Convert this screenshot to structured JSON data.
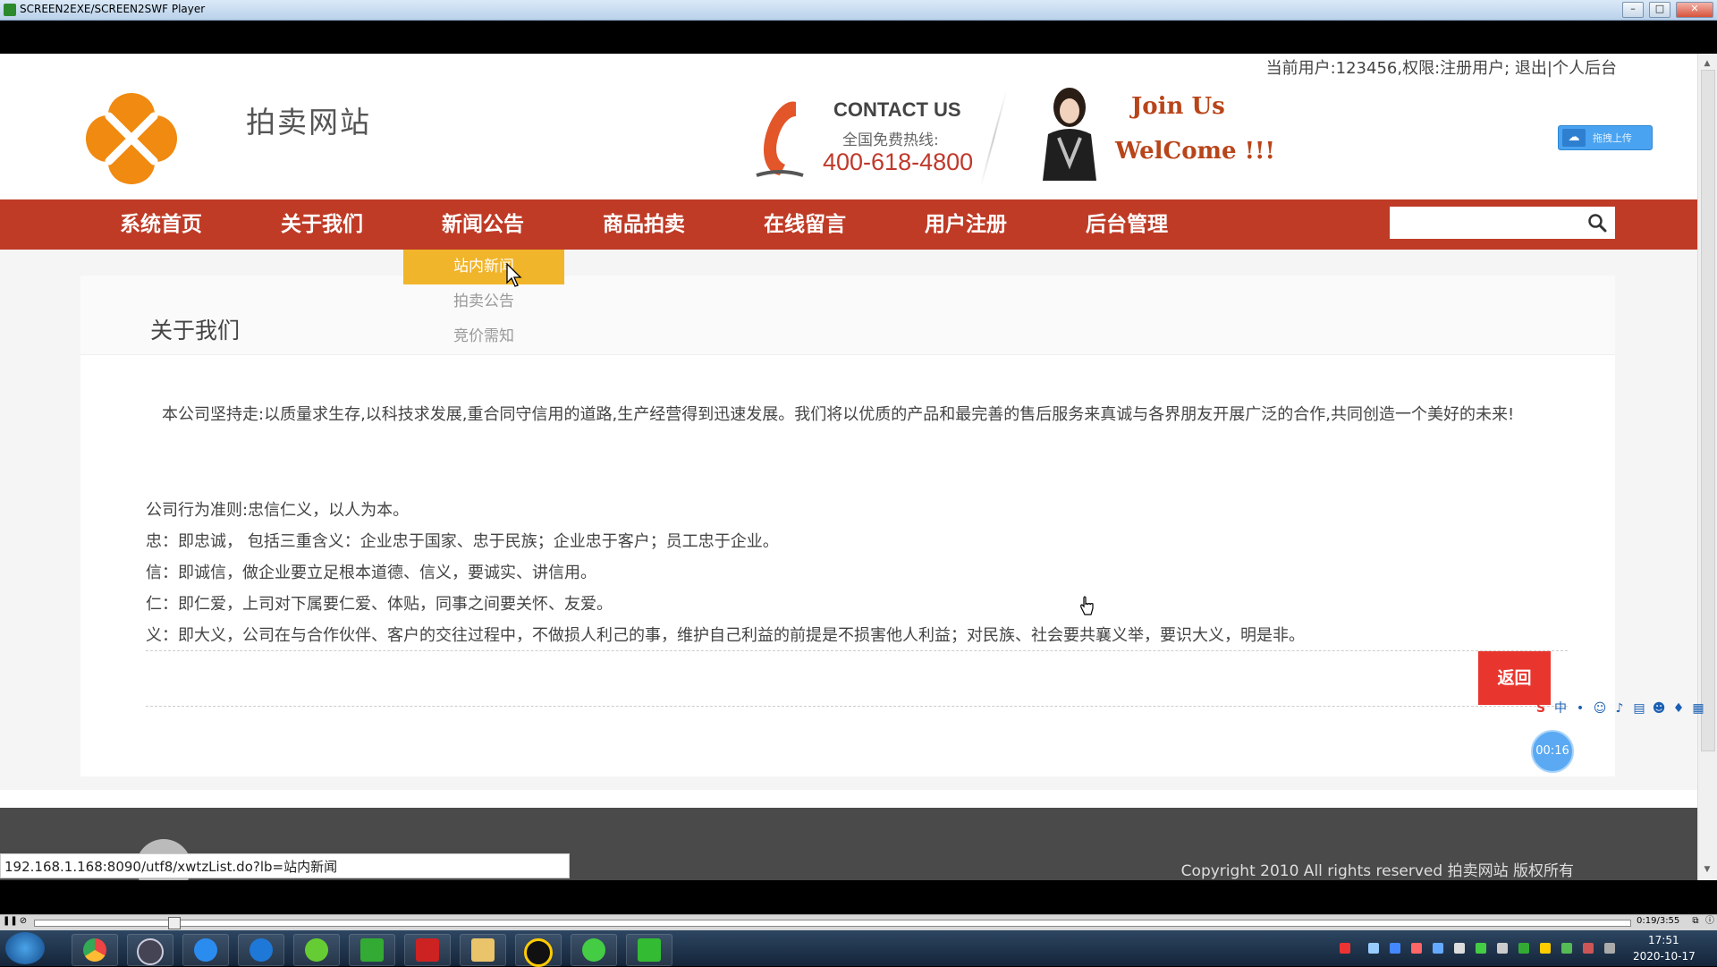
{
  "window": {
    "title": "SCREEN2EXE/SCREEN2SWF Player",
    "minimize": "–",
    "maximize": "□",
    "close": "✕"
  },
  "header": {
    "user_info": "当前用户:123456,权限:注册用户; 退出|个人后台",
    "site_name": "拍卖网站",
    "contact_title": "CONTACT US",
    "contact_sub": "全国免费热线:",
    "contact_number": "400-618-4800",
    "join_line1": "Join Us",
    "join_line2": "WelCome !!!",
    "upload_label": "拖拽上传"
  },
  "nav": {
    "items": [
      "系统首页",
      "关于我们",
      "新闻公告",
      "商品拍卖",
      "在线留言",
      "用户注册",
      "后台管理"
    ],
    "search_placeholder": ""
  },
  "dropdown": {
    "items": [
      "站内新闻",
      "拍卖公告",
      "竞价需知"
    ],
    "active_index": 0
  },
  "content": {
    "title": "关于我们",
    "paragraphs": [
      "　本公司坚持走:以质量求生存,以科技求发展,重合同守信用的道路,生产经营得到迅速发展。我们将以优质的产品和最完善的售后服务来真诚与各界朋友开展广泛的合作,共同创造一个美好的未来!",
      "公司行为准则:忠信仁义，以人为本。",
      "忠：即忠诚， 包括三重含义：企业忠于国家、忠于民族；企业忠于客户；员工忠于企业。",
      "信：即诚信，做企业要立足根本道德、信义，要诚实、讲信用。",
      "仁：即仁爱，上司对下属要仁爱、体贴，同事之间要关怀、友爱。",
      "义：即大义，公司在与合作伙伴、客户的交往过程中，不做损人利己的事，维护自己利益的前提是不损害他人利益；对民族、社会要共襄义举，要识大义，明是非。"
    ],
    "back_button": "返回"
  },
  "footer": {
    "copyright": "Copyright 2010 All rights reserved 拍卖网站 版权所有"
  },
  "status_url": "192.168.1.168:8090/utf8/xwtzList.do?lb=站内新闻",
  "timer": "00:16",
  "player": {
    "timecode": "0:19/3:55"
  },
  "taskbar": {
    "time": "17:51",
    "date": "2020-10-17"
  },
  "colors": {
    "nav_bg": "#bf3b26",
    "dropdown_active": "#f1b52b",
    "back_button": "#e8362f",
    "contact_number": "#c0392b"
  }
}
